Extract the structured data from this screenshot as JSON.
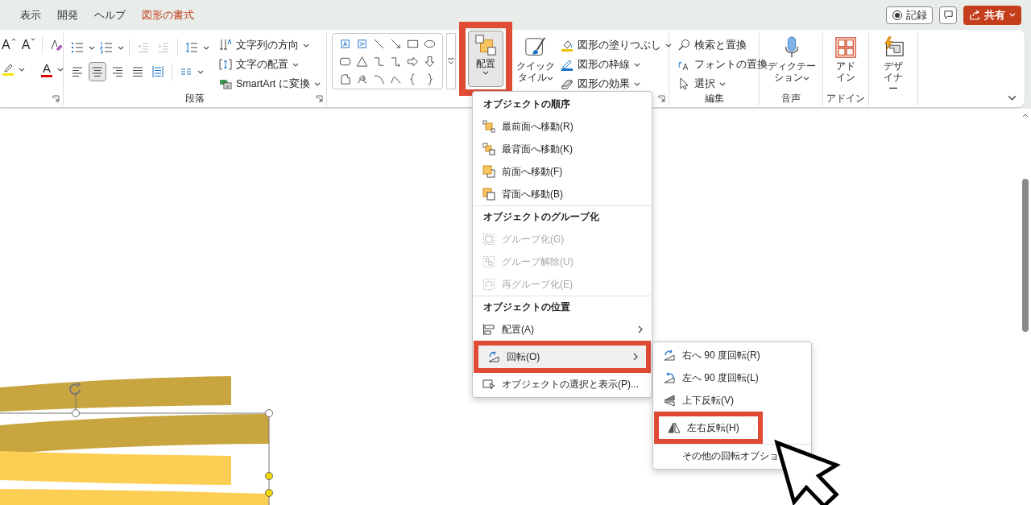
{
  "tabs": [
    {
      "label": "表示",
      "selected": false
    },
    {
      "label": "開発",
      "selected": false
    },
    {
      "label": "ヘルプ",
      "selected": false
    },
    {
      "label": "図形の書式",
      "selected": true
    }
  ],
  "header_buttons": {
    "record": "記録",
    "share": "共有"
  },
  "font_group": {
    "grow_font": "A",
    "shrink_font": "A",
    "font_color": "A"
  },
  "paragraph_group": {
    "label": "段落",
    "indent_buttons": [
      {
        "kind": "decrease",
        "disabled": true
      },
      {
        "kind": "increase",
        "disabled": true
      }
    ],
    "align_buttons": [
      {
        "kind": "left",
        "selected": false
      },
      {
        "kind": "center",
        "selected": true
      },
      {
        "kind": "right",
        "selected": false
      },
      {
        "kind": "justify",
        "selected": false
      },
      {
        "kind": "distributed",
        "selected": false
      }
    ],
    "text_commands": [
      {
        "kind": "direction",
        "label": "文字列の方向"
      },
      {
        "kind": "align",
        "label": "文字の配置"
      },
      {
        "kind": "smartart",
        "label": "SmartArt に変換"
      }
    ]
  },
  "drawing_group": {
    "arrange": {
      "label": "配置",
      "pressed": true,
      "callout": true
    },
    "quick_style": "クイックタイル",
    "format_commands": [
      {
        "kind": "fill",
        "label": "図形の塗りつぶし"
      },
      {
        "kind": "outline",
        "label": "図形の枠線"
      },
      {
        "kind": "effects",
        "label": "図形の効果"
      }
    ]
  },
  "editing_group": {
    "label": "編集",
    "commands": [
      {
        "kind": "find",
        "label": "検索と置換"
      },
      {
        "kind": "replace-font",
        "label": "フォントの置換"
      },
      {
        "kind": "select",
        "label": "選択"
      }
    ]
  },
  "voice_group": {
    "label": "音声",
    "dictate": "ディクテーション"
  },
  "addin_group": {
    "label": "アドイン",
    "addins": "アドイン"
  },
  "designer": {
    "label": "デザイナー"
  },
  "arrange_menu": {
    "sections": [
      {
        "header": "オブジェクトの順序",
        "items": [
          {
            "kind": "bring-to-front",
            "label": "最前面へ移動(R)",
            "disabled": false,
            "selected": false,
            "submenu": false,
            "callout": false
          },
          {
            "kind": "send-to-back",
            "label": "最背面へ移動(K)",
            "disabled": false,
            "selected": false,
            "submenu": false,
            "callout": false
          },
          {
            "kind": "bring-forward",
            "label": "前面へ移動(F)",
            "disabled": false,
            "selected": false,
            "submenu": false,
            "callout": false
          },
          {
            "kind": "send-backward",
            "label": "背面へ移動(B)",
            "disabled": false,
            "selected": false,
            "submenu": false,
            "callout": false
          }
        ]
      },
      {
        "header": "オブジェクトのグループ化",
        "items": [
          {
            "kind": "group",
            "label": "グループ化(G)",
            "disabled": true,
            "selected": false,
            "submenu": false,
            "callout": false
          },
          {
            "kind": "ungroup",
            "label": "グループ解除(U)",
            "disabled": true,
            "selected": false,
            "submenu": false,
            "callout": false
          },
          {
            "kind": "regroup",
            "label": "再グループ化(E)",
            "disabled": true,
            "selected": false,
            "submenu": false,
            "callout": false
          }
        ]
      },
      {
        "header": "オブジェクトの位置",
        "items": [
          {
            "kind": "align",
            "label": "配置(A)",
            "disabled": false,
            "selected": false,
            "submenu": true,
            "callout": false
          },
          {
            "kind": "rotate",
            "label": "回転(O)",
            "disabled": false,
            "selected": true,
            "submenu": true,
            "callout": true
          },
          {
            "kind": "selection-pane",
            "label": "オブジェクトの選択と表示(P)...",
            "disabled": false,
            "selected": false,
            "submenu": false,
            "callout": false
          }
        ]
      }
    ]
  },
  "rotate_menu": {
    "items": [
      {
        "kind": "rotate-right",
        "label": "右へ 90 度回転(R)",
        "callout": false
      },
      {
        "kind": "rotate-left",
        "label": "左へ 90 度回転(L)",
        "callout": false
      },
      {
        "kind": "flip-vertical",
        "label": "上下反転(V)",
        "callout": false
      },
      {
        "kind": "flip-horizontal",
        "label": "左右反転(H)",
        "callout": true
      },
      {
        "kind": "more-options",
        "label": "その他の回転オプショ",
        "callout": false
      }
    ]
  }
}
